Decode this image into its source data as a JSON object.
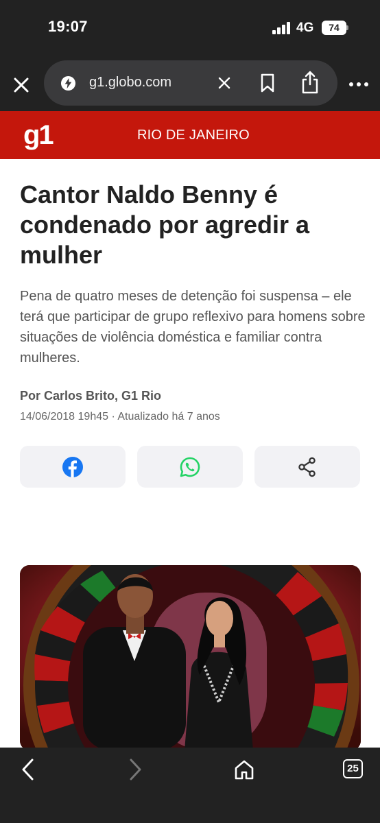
{
  "status_bar": {
    "time": "19:07",
    "network": "4G",
    "battery": "74"
  },
  "browser": {
    "url": "g1.globo.com"
  },
  "site": {
    "logo": "g1",
    "section": "RIO DE JANEIRO",
    "brand_color": "#c4170c"
  },
  "article": {
    "headline": "Cantor Naldo Benny é condenado por agredir a mulher",
    "subheadline": "Pena de quatro meses de detenção foi suspensa – ele terá que participar de grupo reflexivo para homens sobre situações de violência doméstica e familiar contra mulheres.",
    "byline": "Por Carlos Brito, G1 Rio",
    "dateline": "14/06/2018 19h45 · Atualizado há 7 anos"
  },
  "share": {
    "facebook_color": "#1877f2",
    "whatsapp_color": "#25d366",
    "icons": [
      "facebook-icon",
      "whatsapp-icon",
      "share-icon"
    ]
  },
  "bottom_bar": {
    "tab_count": "25"
  }
}
